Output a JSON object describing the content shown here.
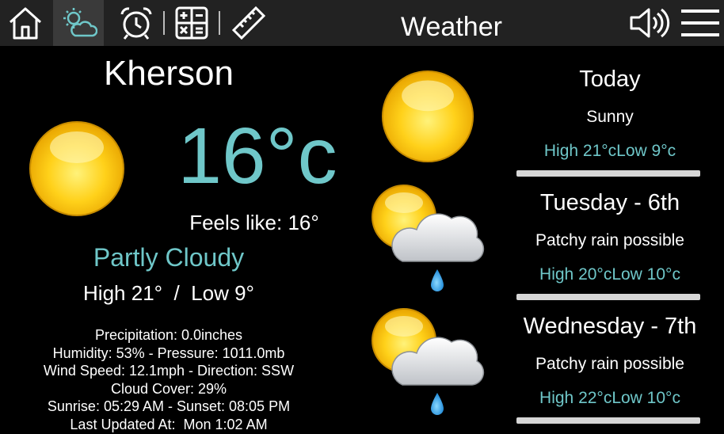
{
  "app": {
    "title": "Weather"
  },
  "nav": {
    "items": [
      {
        "name": "home",
        "icon": "home-icon",
        "active": false
      },
      {
        "name": "weather",
        "icon": "weather-icon",
        "active": true
      },
      {
        "name": "alarm",
        "icon": "alarm-clock-icon",
        "active": false
      },
      {
        "name": "calculator",
        "icon": "calculator-icon",
        "active": false
      },
      {
        "name": "ruler",
        "icon": "ruler-icon",
        "active": false
      }
    ],
    "right": [
      {
        "name": "volume",
        "icon": "speaker-volume-icon"
      },
      {
        "name": "menu",
        "icon": "hamburger-menu-icon"
      }
    ]
  },
  "current": {
    "city": "Kherson",
    "icon": "sunny-icon",
    "temperature": "16°c",
    "feels_like": "Feels like: 16°",
    "condition": "Partly Cloudy",
    "high_low": "High 21°  /  Low 9°",
    "details": [
      "Precipitation: 0.0inches",
      "Humidity: 53% - Pressure: 1011.0mb",
      "Wind Speed: 12.1mph - Direction: SSW",
      "Cloud Cover: 29%",
      "Sunrise: 05:29 AM - Sunset: 08:05 PM",
      "Last Updated At:  Mon 1:02 AM"
    ]
  },
  "forecast": [
    {
      "day": "Today",
      "condition": "Sunny",
      "high": "High 21°c",
      "low": "Low 9°c",
      "icon": "sunny-icon"
    },
    {
      "day": "Tuesday - 6th",
      "condition": "Patchy rain possible",
      "high": "High 20°c",
      "low": "Low 10°c",
      "icon": "sun-cloud-rain-icon"
    },
    {
      "day": "Wednesday - 7th",
      "condition": "Patchy rain possible",
      "high": "High 22°c",
      "low": "Low 10°c",
      "icon": "sun-cloud-rain-icon"
    }
  ],
  "colors": {
    "accent": "#6fc7c9",
    "topbar": "#222222",
    "background": "#000000",
    "divider": "#d6d6d6"
  }
}
